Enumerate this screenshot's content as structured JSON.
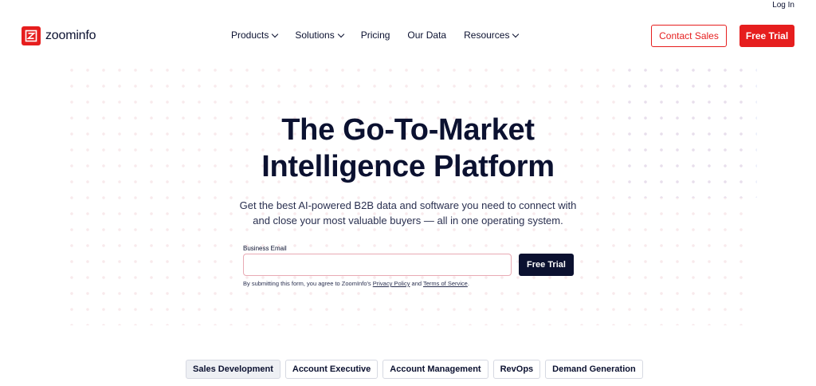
{
  "header": {
    "login_label": "Log In",
    "logo_text": "zoominfo",
    "nav": [
      {
        "label": "Products",
        "dropdown": true
      },
      {
        "label": "Solutions",
        "dropdown": true
      },
      {
        "label": "Pricing",
        "dropdown": false
      },
      {
        "label": "Our Data",
        "dropdown": false
      },
      {
        "label": "Resources",
        "dropdown": true
      }
    ],
    "contact_sales_label": "Contact Sales",
    "free_trial_label": "Free Trial"
  },
  "hero": {
    "title_line1": "The Go-To-Market",
    "title_line2": "Intelligence Platform",
    "subtitle_line1": "Get the best AI-powered B2B data and software you need to connect with",
    "subtitle_line2": "and close your most valuable buyers — all in one operating system."
  },
  "form": {
    "email_label": "Business Email",
    "email_value": "",
    "email_placeholder": "",
    "submit_label": "Free Trial",
    "disclaimer_prefix": "By submitting this form, you agree to ZoomInfo's ",
    "privacy_link": "Privacy Policy",
    "disclaimer_and": " and ",
    "terms_link": "Terms of Service",
    "disclaimer_suffix": "."
  },
  "role_tabs": [
    {
      "label": "Sales Development",
      "active": true
    },
    {
      "label": "Account Executive",
      "active": false
    },
    {
      "label": "Account Management",
      "active": false
    },
    {
      "label": "RevOps",
      "active": false
    },
    {
      "label": "Demand Generation",
      "active": false
    }
  ],
  "colors": {
    "brand_red": "#e61e1e",
    "navy": "#0b1130"
  }
}
